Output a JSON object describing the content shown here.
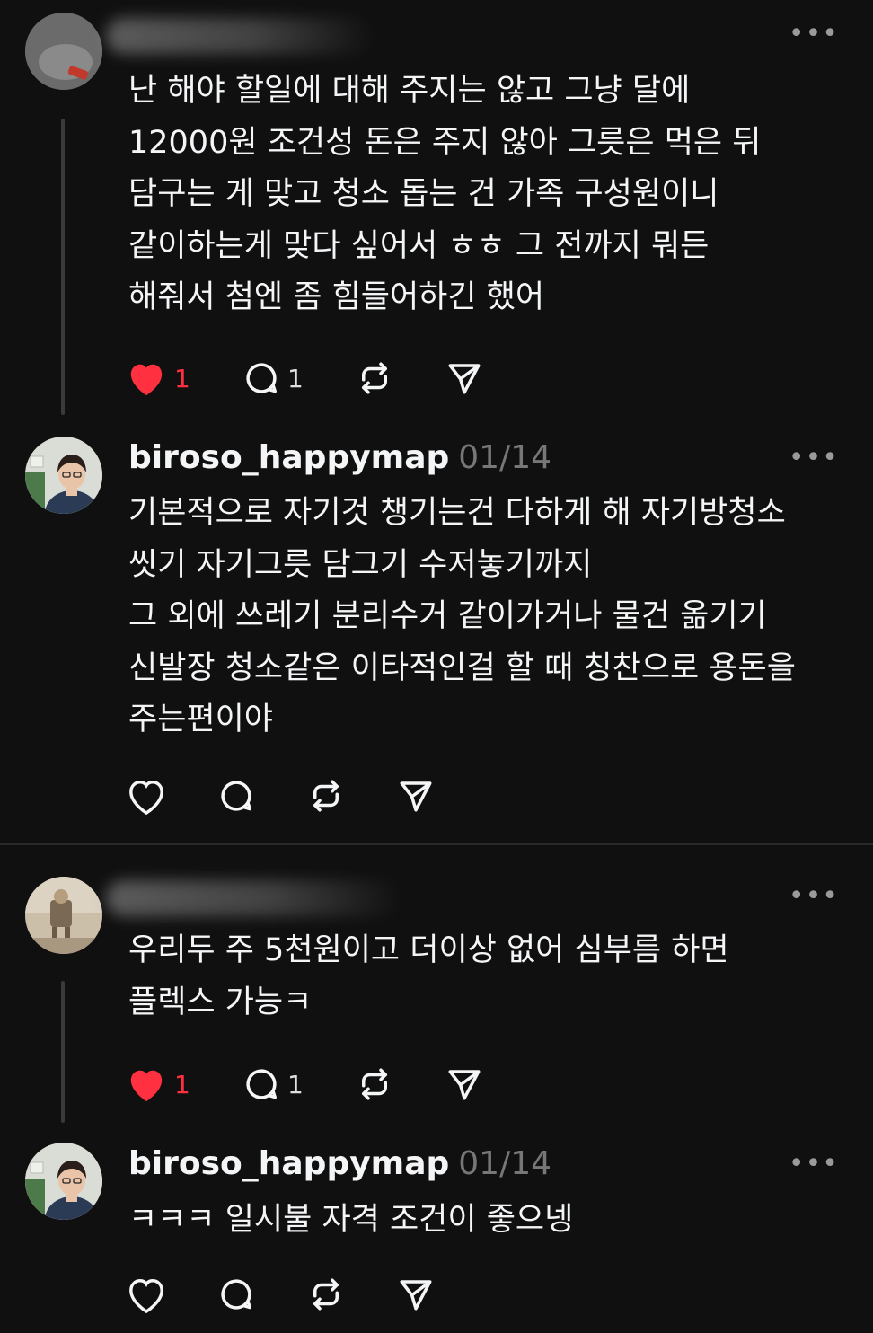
{
  "colors": {
    "background": "#101010",
    "text": "#f3f5f7",
    "muted": "#777777",
    "like": "#ff3040",
    "thread_line": "#3a3a3a"
  },
  "posts": [
    {
      "username": "",
      "date": "",
      "text": "난 해야 할일에 대해 주지는 않고 그냥 달에\n12000원 조건성 돈은 주지 않아 그릇은 먹은 뒤\n담구는 게 맞고 청소 돕는 건 가족 구성원이니\n같이하는게 맞다 싶어서 ㅎㅎ 그 전까지 뭐든\n해줘서 첨엔 좀 힘들어하긴 했어",
      "like_count": "1",
      "reply_count": "1",
      "liked": true
    },
    {
      "username": "biroso_happymap",
      "date": "01/14",
      "text": "기본적으로 자기것 챙기는건 다하게 해 자기방청소\n씻기 자기그릇 담그기 수저놓기까지\n그 외에 쓰레기 분리수거 같이가거나 물건 옮기기\n신발장 청소같은 이타적인걸 할 때 칭찬으로 용돈을\n주는편이야",
      "like_count": "",
      "reply_count": "",
      "liked": false
    },
    {
      "username": "",
      "date": "",
      "text": "우리두 주 5천원이고 더이상 없어 심부름 하면\n플렉스 가능ㅋ",
      "like_count": "1",
      "reply_count": "1",
      "liked": true
    },
    {
      "username": "biroso_happymap",
      "date": "01/14",
      "text": "ㅋㅋㅋ 일시불 자격 조건이 좋으넹",
      "like_count": "",
      "reply_count": "",
      "liked": false
    }
  ],
  "icons": {
    "more": "more-horizontal-icon",
    "like": "heart-icon",
    "reply": "comment-bubble-icon",
    "repost": "repost-icon",
    "share": "send-icon"
  }
}
